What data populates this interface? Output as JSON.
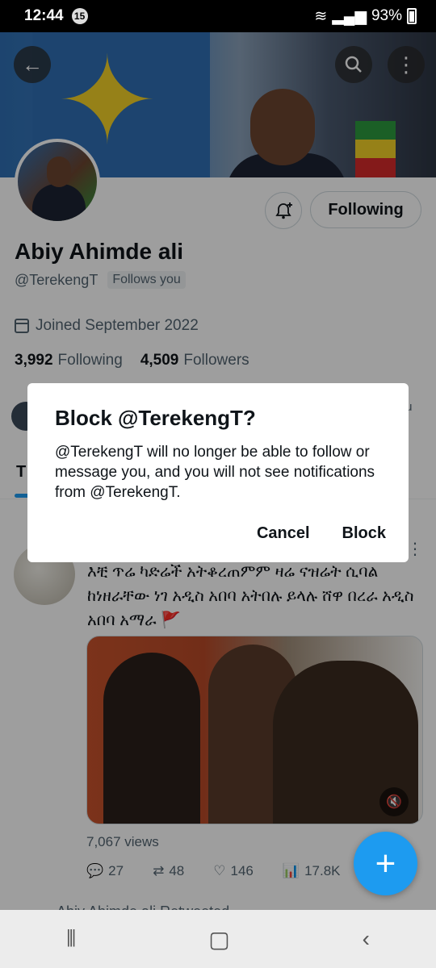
{
  "status_bar": {
    "time": "12:44",
    "notification_count": "15",
    "battery": "93%"
  },
  "profile": {
    "name": "Abiy Ahimde ali",
    "handle": "@TerekengT",
    "follows_you": "Follows you",
    "joined": "Joined September 2022",
    "following_count": "3,992",
    "following_label": "Following",
    "followers_count": "4,509",
    "followers_label": "Followers",
    "following_button": "Following"
  },
  "tabs": {
    "first_letter": "T"
  },
  "tweet": {
    "text": "እቺ ጥሬ ካድሬች አትቆረጠምም ዛሬ ናዝሬት ሲባል ከነዘራቸው ነገ አዲስ አበባ አትበሉ ይላሉ ሸዋ በረራ አዲስ አበባ አማራ 🚩",
    "views": "7,067 views",
    "replies": "27",
    "retweets": "48",
    "likes": "146",
    "analytics": "17.8K"
  },
  "behind_text": "tu",
  "next_tweet_text": "Abiy Ahimde ali Retweeted",
  "dialog": {
    "title": "Block @TerekengT?",
    "body": "@TerekengT will no longer be able to follow or message you, and you will not see notifications from @TerekengT.",
    "cancel": "Cancel",
    "block": "Block"
  },
  "colors": {
    "accent": "#1d9bf0",
    "text": "#0f1419",
    "muted": "#536471"
  }
}
